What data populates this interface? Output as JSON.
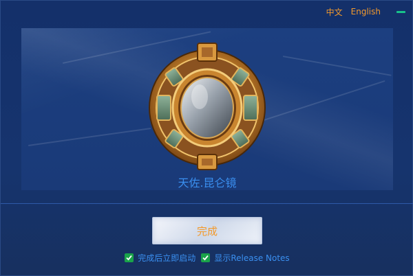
{
  "topbar": {
    "lang_zh": "中文",
    "lang_en": "English",
    "minimize_icon": "minimize-icon"
  },
  "banner": {
    "product_name": "天佐.昆仑镜",
    "logo_icon": "bronze-mirror-icon"
  },
  "actions": {
    "finish_label": "完成"
  },
  "options": [
    {
      "label": "完成后立即启动",
      "checked": true
    },
    {
      "label": "显示Release Notes",
      "checked": true
    }
  ],
  "colors": {
    "accent_orange": "#f39a2c",
    "text_blue": "#3a8ff0",
    "check_green": "#1aa34a",
    "minimize_green": "#18c38a",
    "background": "#14306a"
  }
}
